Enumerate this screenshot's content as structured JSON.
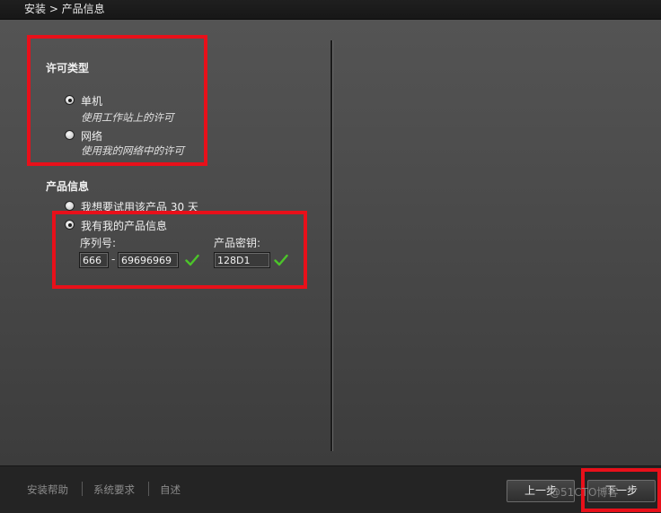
{
  "window": {
    "breadcrumb": "安装 > 产品信息"
  },
  "license_type": {
    "title": "许可类型",
    "options": [
      {
        "label": "单机",
        "description": "使用工作站上的许可",
        "selected": true
      },
      {
        "label": "网络",
        "description": "使用我的网络中的许可",
        "selected": false
      }
    ]
  },
  "product_info": {
    "title": "产品信息",
    "options": [
      {
        "label": "我想要试用该产品 30 天",
        "selected": false
      },
      {
        "label": "我有我的产品信息",
        "selected": true
      }
    ],
    "serial_label": "序列号:",
    "serial_prefix": "666",
    "serial_separator": "-",
    "serial_number": "69696969",
    "key_label": "产品密钥:",
    "product_key": "128D1"
  },
  "footer": {
    "links": [
      "安装帮助",
      "系统要求",
      "自述"
    ],
    "back_label": "上一步",
    "next_label": "下一步"
  },
  "watermark": "@51CTO博客",
  "colors": {
    "highlight_red": "#e8101a",
    "check_green": "#4cc52a"
  },
  "icons": {
    "serial_check": "check-icon",
    "key_check": "check-icon"
  }
}
